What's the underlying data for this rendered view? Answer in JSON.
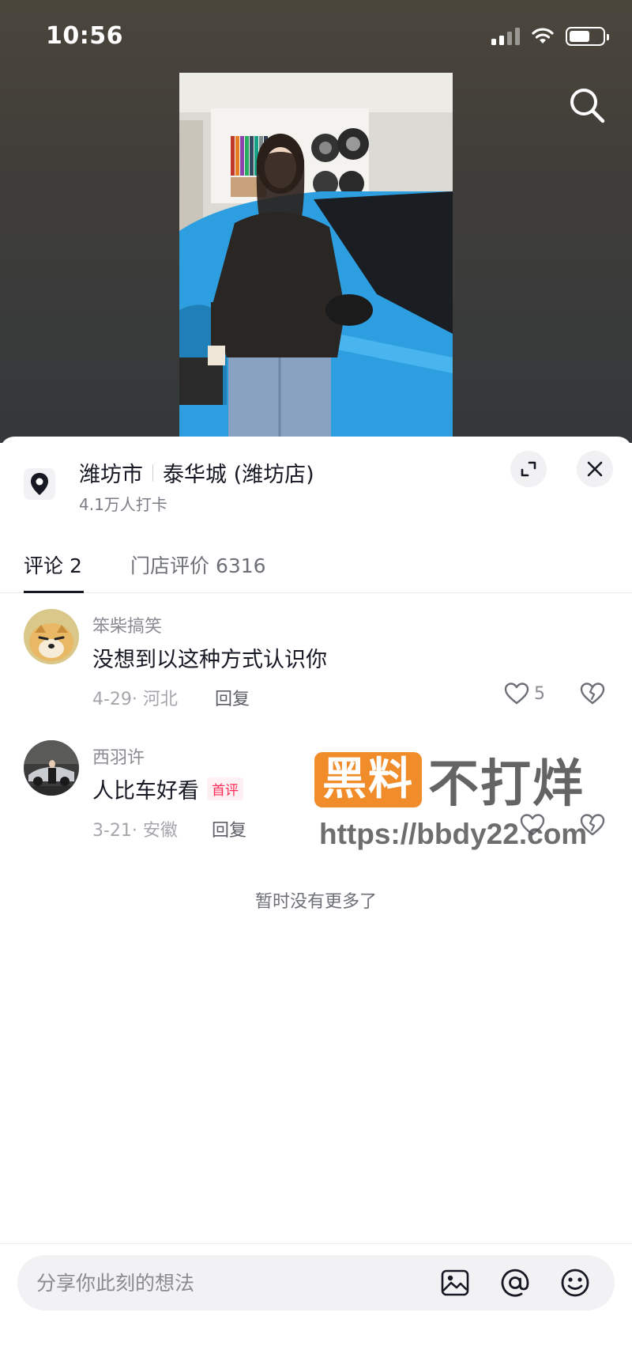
{
  "status_bar": {
    "time": "10:56"
  },
  "location": {
    "city": "潍坊市",
    "place": "泰华城 (潍坊店)",
    "checkins": "4.1万人打卡"
  },
  "tabs": [
    {
      "label": "评论 2",
      "active": true
    },
    {
      "label": "门店评价 6316",
      "active": false
    }
  ],
  "comments": [
    {
      "user": "笨柴搞笑",
      "text": "没想到以这种方式认识你",
      "badge": "",
      "date": "4-29· 河北",
      "reply": "回复",
      "likes": "5"
    },
    {
      "user": "西羽许",
      "text": "人比车好看",
      "badge": "首评",
      "date": "3-21· 安徽",
      "reply": "回复",
      "likes": ""
    }
  ],
  "no_more": "暂时没有更多了",
  "watermark": {
    "brand": "黑料",
    "slogan": "不打烊",
    "url": "https://bbdy22.com"
  },
  "input": {
    "placeholder": "分享你此刻的想法"
  },
  "colors": {
    "accent": "#fe2c55",
    "watermark_orange": "#f08c2a",
    "car_blue": "#2d9fe0"
  }
}
